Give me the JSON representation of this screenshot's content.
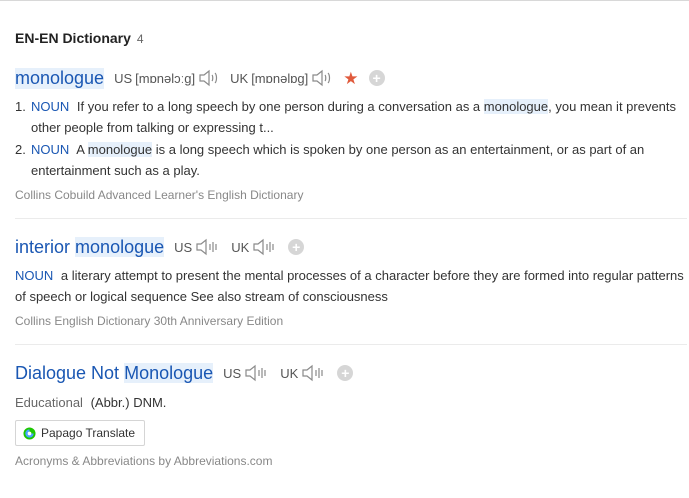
{
  "top_section": {
    "title": "EN-EN Dictionary",
    "count": "4"
  },
  "entries": [
    {
      "headword": "monologue",
      "us_label": "US",
      "us_ipa": "[mɒnəlɔːɡ]",
      "uk_label": "UK",
      "uk_ipa": "[mɒnəlɒɡ]",
      "definitions": [
        {
          "num": "1.",
          "pos": "NOUN",
          "text_before": "If you refer to a long speech by one person during a conversation as a",
          "highlight": "monologue",
          "text_after": ", you mean it prevents other people from talking or expressing t..."
        },
        {
          "num": "2.",
          "pos": "NOUN",
          "text_before": "A",
          "highlight": "monologue",
          "text_after": "is a long speech which is spoken by one person as an entertainment, or as part of an entertainment such as a play."
        }
      ],
      "source": "Collins Cobuild Advanced Learner's English Dictionary"
    },
    {
      "headword_prefix": "interior",
      "headword_highlight": "monologue",
      "us_label": "US",
      "uk_label": "UK",
      "pos": "NOUN",
      "definition": "a literary attempt to present the mental processes of a character before they are formed into regular patterns of speech or logical sequence See also stream of consciousness",
      "source": "Collins English Dictionary 30th Anniversary Edition"
    },
    {
      "headword_prefix": "Dialogue Not",
      "headword_highlight": "Monologue",
      "us_label": "US",
      "uk_label": "UK",
      "category": "Educational",
      "definition": "(Abbr.) DNM.",
      "translate_button": "Papago Translate",
      "source": "Acronyms & Abbreviations by Abbreviations.com"
    }
  ],
  "colors": {
    "link_blue": "#1a57b3",
    "highlight": "#e6f0fb",
    "star": "#e05a3c"
  },
  "icons": [
    "speaker-icon",
    "star-icon",
    "plus-icon",
    "papago-icon"
  ]
}
